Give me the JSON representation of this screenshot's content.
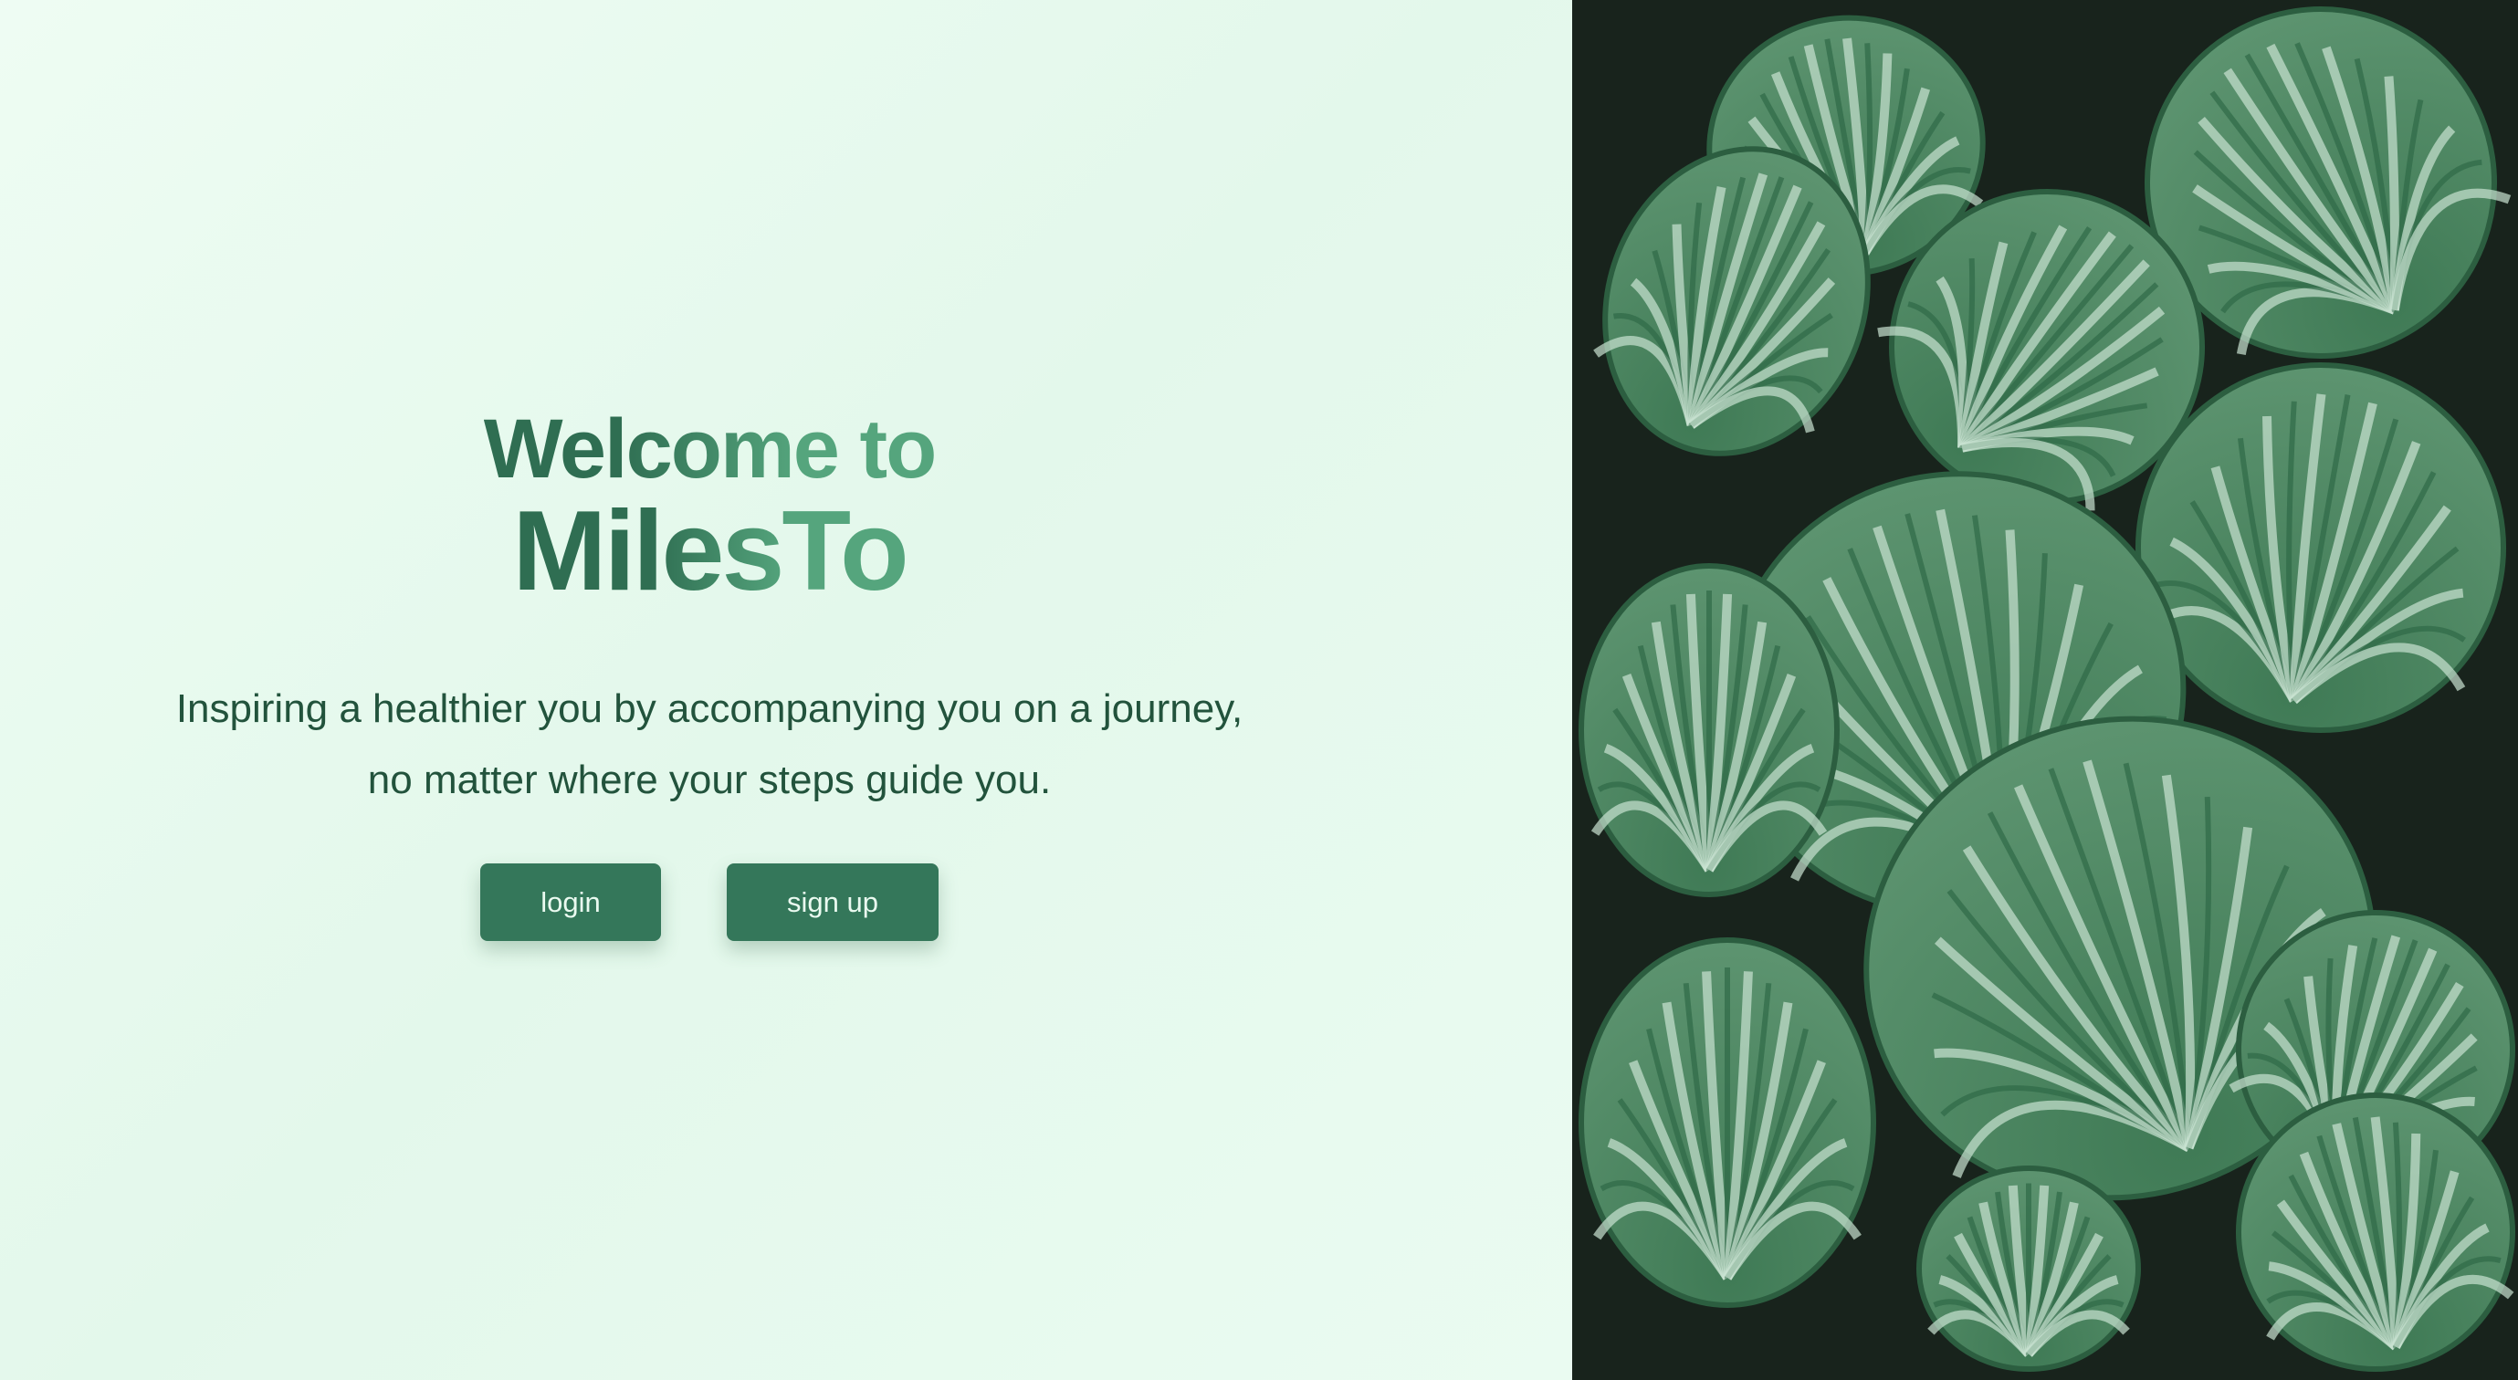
{
  "hero": {
    "title_line1": "Welcome to",
    "title_line2": "MilesTo",
    "tagline_line1": "Inspiring a healthier you by accompanying you on a journey,",
    "tagline_line2": "no matter where your steps guide you."
  },
  "actions": {
    "login_label": "login",
    "signup_label": "sign up"
  },
  "colors": {
    "accent": "#34775a",
    "background": "#e8faef",
    "text": "#22533c"
  }
}
